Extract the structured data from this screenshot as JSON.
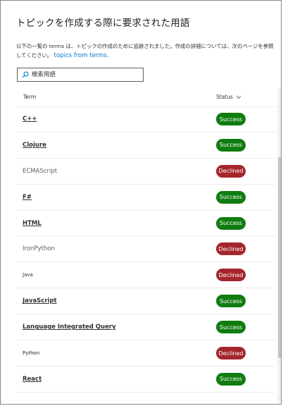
{
  "dialog": {
    "title": "トピックを作成する際に要求された用語",
    "description": "以下の一覧の terms は、トピックの作成のために追跡されました。作成の詳細については、次のページを参照してください。",
    "link_text": "topics from terms."
  },
  "search": {
    "icon": "search-icon",
    "placeholder": "検索用語"
  },
  "table": {
    "columns": {
      "term": "Term",
      "status": "Status"
    },
    "rows": [
      {
        "term": "C++",
        "status": "Success",
        "style": "link"
      },
      {
        "term": "Clojure",
        "status": "Success",
        "style": "link"
      },
      {
        "term": "ECMAScript",
        "status": "Declined",
        "style": "plain"
      },
      {
        "term": "F#",
        "status": "Success",
        "style": "link"
      },
      {
        "term": "HTML",
        "status": "Success",
        "style": "link"
      },
      {
        "term": "IronPython",
        "status": "Declined",
        "style": "plain"
      },
      {
        "term": "Java",
        "status": "Declined",
        "style": "small"
      },
      {
        "term": "JavaScript",
        "status": "Success",
        "style": "link"
      },
      {
        "term": "Language Integrated Query",
        "status": "Success",
        "style": "link"
      },
      {
        "term": "Python",
        "status": "Declined",
        "style": "small"
      },
      {
        "term": "React",
        "status": "Success",
        "style": "link"
      }
    ]
  },
  "colors": {
    "success": "#107c10",
    "declined": "#a4262c",
    "link": "#0078d4"
  }
}
